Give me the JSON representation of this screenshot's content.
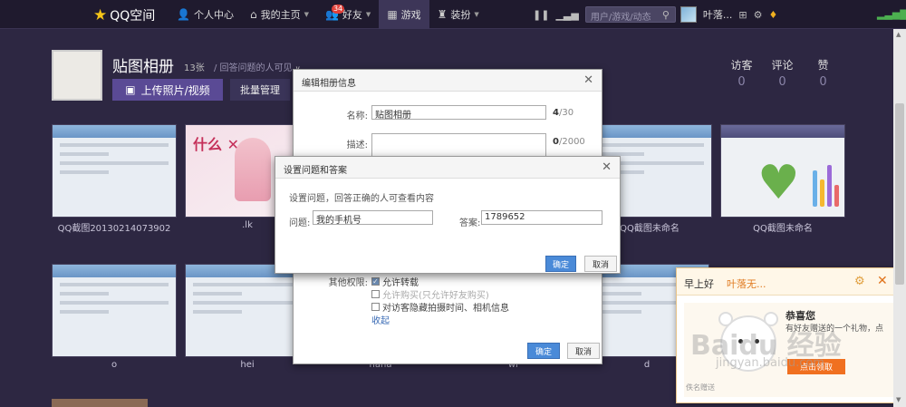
{
  "topbar": {
    "logo": "QQ空间",
    "nav": [
      {
        "icon": "person-icon",
        "label": "个人中心",
        "caret": false
      },
      {
        "icon": "home-icon",
        "label": "我的主页",
        "caret": true
      },
      {
        "icon": "friends-icon",
        "label": "好友",
        "badge": "34",
        "caret": true
      },
      {
        "icon": "game-icon",
        "label": "游戏",
        "active": true
      },
      {
        "icon": "shirt-icon",
        "label": "装扮",
        "caret": true
      }
    ],
    "search_placeholder": "用户/游戏/动态",
    "username": "叶落..."
  },
  "album": {
    "title": "贴图相册",
    "count": "13张",
    "visibility": "/ 回答问题的人可见",
    "upload_label": "上传照片/视频",
    "batch_label": "批量管理",
    "stats": [
      {
        "label": "访客",
        "value": "0"
      },
      {
        "label": "评论",
        "value": "0"
      },
      {
        "label": "赞",
        "value": "0"
      }
    ]
  },
  "photos": {
    "row1": [
      "QQ截图20130214073902",
      ".lk",
      "",
      "",
      "",
      "QQ截图未命名",
      "QQ截图未命名"
    ],
    "row2": [
      "o",
      "hei",
      "haha",
      "wr",
      "d",
      ""
    ]
  },
  "album_dialog": {
    "title": "编辑相册信息",
    "name_label": "名称:",
    "name_value": "贴图相册",
    "name_count": "4",
    "name_max": "/30",
    "desc_label": "描述:",
    "desc_count": "0",
    "desc_max": "/2000",
    "other_perm_label": "其他权限:",
    "perm_repost": "允许转载",
    "perm_buy": "允许购买(只允许好友购买)",
    "perm_hide": "对访客隐藏拍摄时间、相机信息",
    "collapse": "收起",
    "ok": "确定",
    "cancel": "取消"
  },
  "question_dialog": {
    "title": "设置问题和答案",
    "hint": "设置问题，回答正确的人可查看内容",
    "question_label": "问题:",
    "question_value": "我的手机号",
    "answer_label": "答案:",
    "answer_value": "1789652",
    "ok": "确定",
    "cancel": "取消"
  },
  "notification": {
    "greeting": "早上好",
    "name": "叶落无...",
    "title": "恭喜您",
    "message": "有好友赠送的一个礼物，点",
    "claim": "点击领取",
    "footer": "佚名赠送"
  },
  "watermark": {
    "main": "Baidu 经验",
    "sub": "jingyan.baidu.com"
  }
}
